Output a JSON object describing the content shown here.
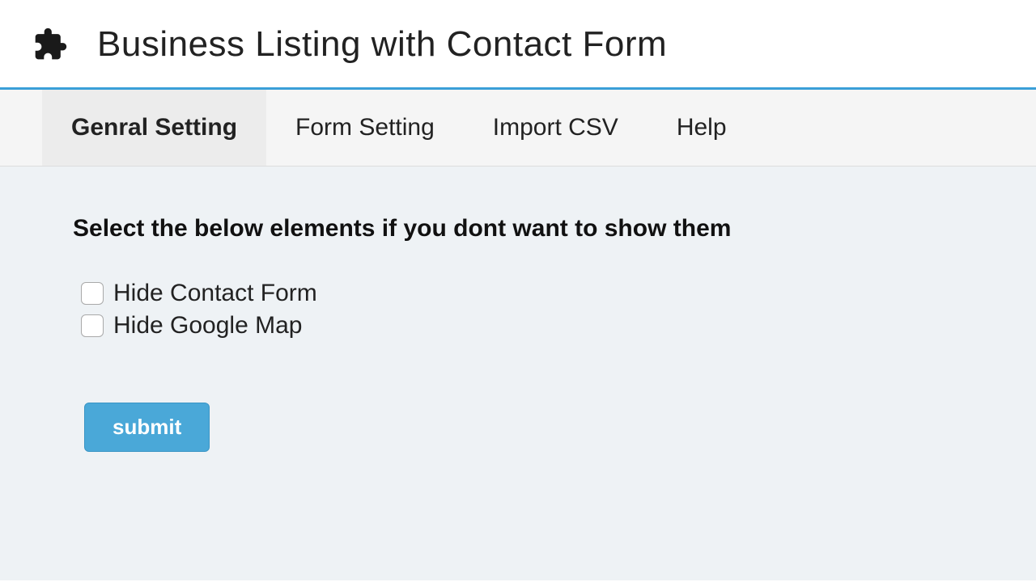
{
  "header": {
    "title": "Business Listing with Contact Form"
  },
  "tabs": [
    {
      "label": "Genral Setting"
    },
    {
      "label": "Form Setting"
    },
    {
      "label": "Import CSV"
    },
    {
      "label": "Help"
    }
  ],
  "content": {
    "heading": "Select the below elements if you dont want to show them",
    "options": [
      {
        "label": "Hide Contact Form"
      },
      {
        "label": "Hide Google Map"
      }
    ],
    "submit_label": "submit"
  }
}
